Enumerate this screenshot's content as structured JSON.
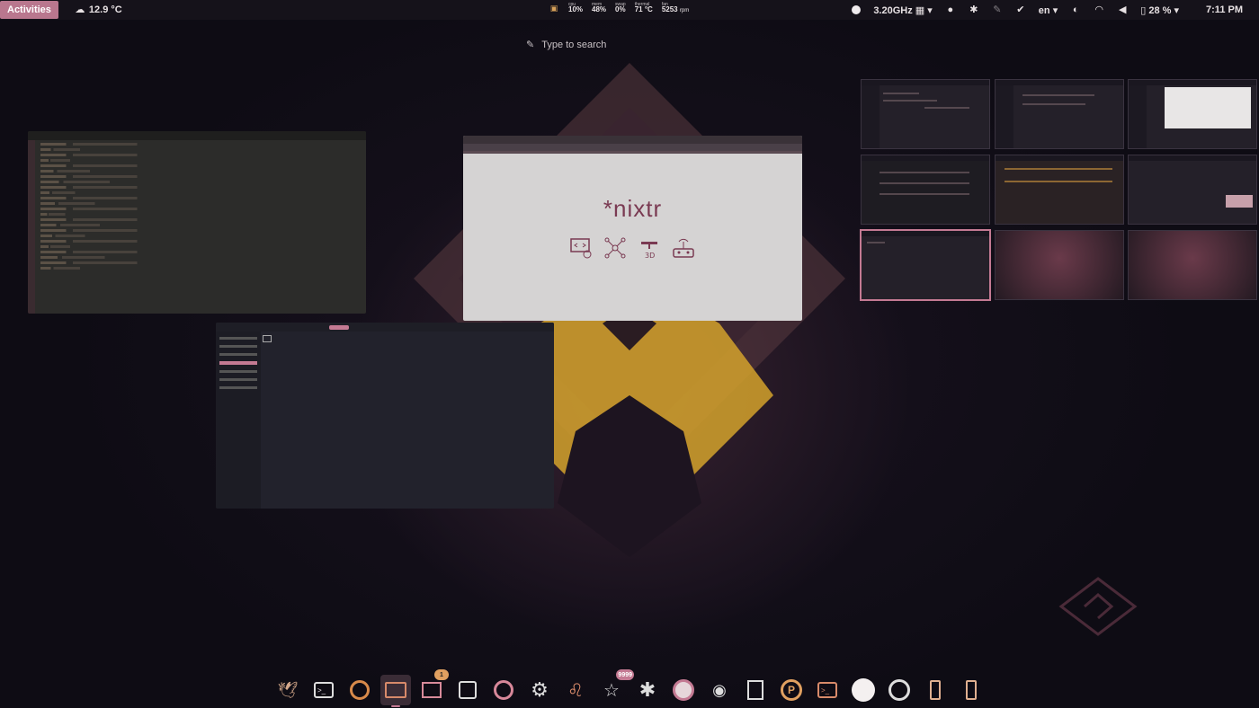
{
  "topbar": {
    "activities": "Activities",
    "weather": "12.9 °C",
    "sys": {
      "cpu_label": "cpu",
      "cpu_value": "10%",
      "mem_label": "mem",
      "mem_value": "48%",
      "swap_label": "swap",
      "swap_value": "0%",
      "thermal_label": "thermal",
      "thermal_value": "71 °C",
      "fan_label": "fan",
      "fan_value": "5253",
      "fan_unit": "rpm"
    },
    "cpu_freq": "3.20GHz",
    "lang": "en",
    "battery": "28 %",
    "clock": "7:11 PM"
  },
  "search": {
    "placeholder": "Type to search"
  },
  "browser": {
    "logo": "*nixtr"
  },
  "dock": {
    "mail_badge": "1",
    "star_badge": "9999"
  },
  "colors": {
    "accent": "#c47a93",
    "topbar": "#15121a",
    "activities_bg": "#b9778e"
  }
}
